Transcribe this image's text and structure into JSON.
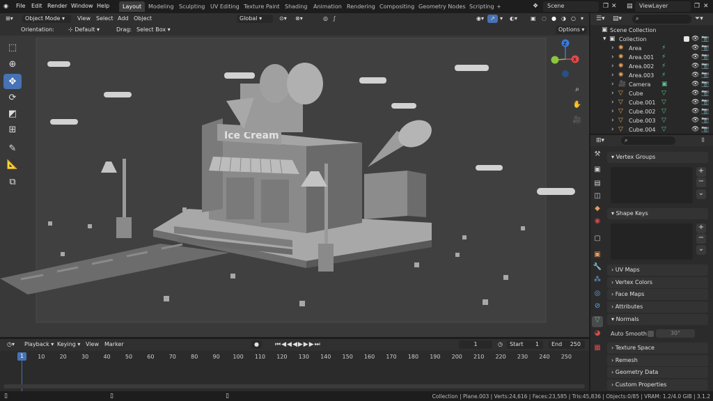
{
  "colors": {
    "accent": "#4772b3",
    "mesh": "#8f8f8f",
    "viewport_bg": "#393939",
    "x_axis": "#e24b4b",
    "y_axis": "#8cc63f",
    "z_axis": "#3b7bd8"
  },
  "menubar": {
    "items": [
      "File",
      "Edit",
      "Render",
      "Window",
      "Help"
    ]
  },
  "workspace_tabs": [
    "Layout",
    "Modeling",
    "Sculpting",
    "UV Editing",
    "Texture Paint",
    "Shading",
    "Animation",
    "Rendering",
    "Compositing",
    "Geometry Nodes",
    "Scripting"
  ],
  "workspace_add": "+",
  "scene": {
    "name": "Scene",
    "view_layer": "ViewLayer"
  },
  "viewport_header": {
    "mode": "Object Mode",
    "menus": [
      "View",
      "Select",
      "Add",
      "Object"
    ],
    "transform_orientation": "Global"
  },
  "tool_header": {
    "orientation_label": "Orientation:",
    "orientation_value": "Default",
    "drag_label": "Drag:",
    "drag_value": "Select Box",
    "options": "Options"
  },
  "viewport": {
    "sign_text": "Ice Cream",
    "gizmo": {
      "x": "X",
      "y": "Y",
      "z": "Z"
    }
  },
  "toolbar_tools": [
    "select-box-tool",
    "cursor-tool",
    "move-tool",
    "rotate-tool",
    "scale-tool",
    "transform-tool",
    "annotate-tool",
    "measure-tool",
    "add-cube-tool"
  ],
  "timeline": {
    "menus": [
      "Playback",
      "Keying",
      "View",
      "Marker"
    ],
    "current_frame": "1",
    "start_label": "Start",
    "start": "1",
    "end_label": "End",
    "end": "250",
    "ruler": [
      "10",
      "20",
      "30",
      "40",
      "50",
      "60",
      "70",
      "80",
      "90",
      "100",
      "110",
      "120",
      "130",
      "140",
      "150",
      "160",
      "170",
      "180",
      "190",
      "200",
      "210",
      "220",
      "230",
      "240",
      "250"
    ]
  },
  "outliner": {
    "root": "Scene Collection",
    "collection": "Collection",
    "items": [
      {
        "name": "Area",
        "kind": "light"
      },
      {
        "name": "Area.001",
        "kind": "light"
      },
      {
        "name": "Area.002",
        "kind": "light"
      },
      {
        "name": "Area.003",
        "kind": "light"
      },
      {
        "name": "Camera",
        "kind": "camera"
      },
      {
        "name": "Cube",
        "kind": "mesh"
      },
      {
        "name": "Cube.001",
        "kind": "mesh"
      },
      {
        "name": "Cube.002",
        "kind": "mesh"
      },
      {
        "name": "Cube.003",
        "kind": "mesh"
      },
      {
        "name": "Cube.004",
        "kind": "mesh"
      }
    ]
  },
  "properties": {
    "panels": [
      "Vertex Groups",
      "Shape Keys",
      "UV Maps",
      "Vertex Colors",
      "Face Maps",
      "Attributes",
      "Normals",
      "Texture Space",
      "Remesh",
      "Geometry Data",
      "Custom Properties"
    ],
    "auto_smooth_label": "Auto Smooth",
    "auto_smooth_angle": "30°"
  },
  "status": "Collection | Plane.003 | Verts:24,616 | Faces:23,585 | Tris:45,836 | Objects:0/85 | VRAM: 1.2/4.0 GiB | 3.1.2"
}
